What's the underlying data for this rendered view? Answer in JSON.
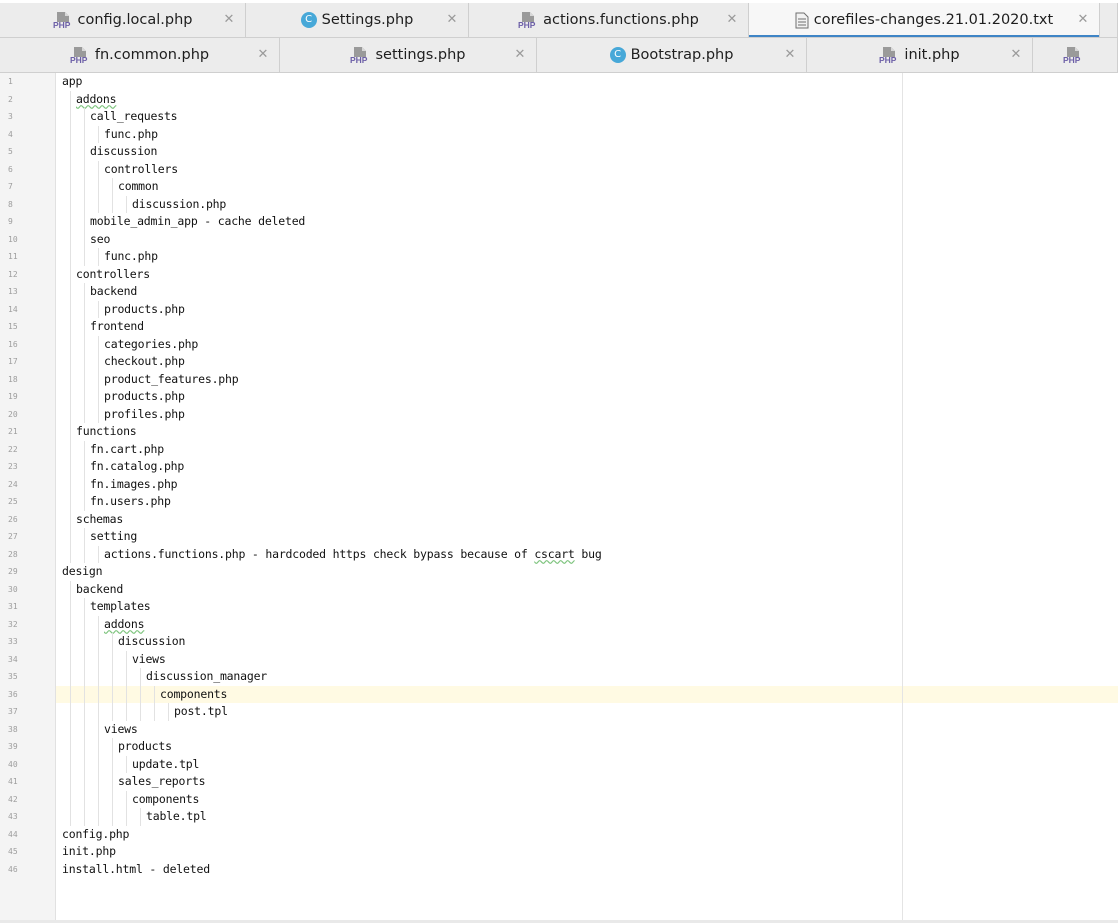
{
  "tabs_row_1": [
    {
      "label": "config.local.php",
      "icon": "php-file-icon",
      "active": false
    },
    {
      "label": "Settings.php",
      "icon": "class-icon",
      "active": false
    },
    {
      "label": "actions.functions.php",
      "icon": "php-file-icon",
      "active": false
    },
    {
      "label": "corefiles-changes.21.01.2020.txt",
      "icon": "text-file-icon",
      "active": true
    },
    {
      "label": "",
      "icon": "",
      "active": false
    }
  ],
  "tabs_row_2": [
    {
      "label": "fn.common.php",
      "icon": "php-file-icon",
      "active": false
    },
    {
      "label": "settings.php",
      "icon": "php-file-icon",
      "active": false
    },
    {
      "label": "Bootstrap.php",
      "icon": "class-icon",
      "active": false
    },
    {
      "label": "init.php",
      "icon": "php-file-icon",
      "active": false
    },
    {
      "label": "",
      "icon": "php-file-icon",
      "active": false
    }
  ],
  "icon_text": {
    "php": "PHP",
    "class": "C"
  },
  "close_glyph": "✕",
  "colors": {
    "active_tab_accent": "#3f85c6",
    "caret_line": "#fffae3",
    "class_icon": "#47a8d8",
    "php_icon": "#6c5fa7"
  },
  "caret_line_number": 36,
  "lines": [
    {
      "n": "1",
      "indent": 0,
      "text": "app"
    },
    {
      "n": "2",
      "indent": 1,
      "text": "addons",
      "squiggle": true
    },
    {
      "n": "3",
      "indent": 2,
      "text": "call_requests"
    },
    {
      "n": "4",
      "indent": 3,
      "text": "func.php"
    },
    {
      "n": "5",
      "indent": 2,
      "text": "discussion"
    },
    {
      "n": "6",
      "indent": 3,
      "text": "controllers"
    },
    {
      "n": "7",
      "indent": 4,
      "text": "common"
    },
    {
      "n": "8",
      "indent": 5,
      "text": "discussion.php"
    },
    {
      "n": "9",
      "indent": 2,
      "text": "mobile_admin_app - cache deleted"
    },
    {
      "n": "10",
      "indent": 2,
      "text": "seo"
    },
    {
      "n": "11",
      "indent": 3,
      "text": "func.php"
    },
    {
      "n": "12",
      "indent": 1,
      "text": "controllers"
    },
    {
      "n": "13",
      "indent": 2,
      "text": "backend"
    },
    {
      "n": "14",
      "indent": 3,
      "text": "products.php"
    },
    {
      "n": "15",
      "indent": 2,
      "text": "frontend"
    },
    {
      "n": "16",
      "indent": 3,
      "text": "categories.php"
    },
    {
      "n": "17",
      "indent": 3,
      "text": "checkout.php"
    },
    {
      "n": "18",
      "indent": 3,
      "text": "product_features.php"
    },
    {
      "n": "19",
      "indent": 3,
      "text": "products.php"
    },
    {
      "n": "20",
      "indent": 3,
      "text": "profiles.php"
    },
    {
      "n": "21",
      "indent": 1,
      "text": "functions"
    },
    {
      "n": "22",
      "indent": 2,
      "text": "fn.cart.php"
    },
    {
      "n": "23",
      "indent": 2,
      "text": "fn.catalog.php"
    },
    {
      "n": "24",
      "indent": 2,
      "text": "fn.images.php"
    },
    {
      "n": "25",
      "indent": 2,
      "text": "fn.users.php"
    },
    {
      "n": "26",
      "indent": 1,
      "text": "schemas"
    },
    {
      "n": "27",
      "indent": 2,
      "text": "setting"
    },
    {
      "n": "28",
      "indent": 3,
      "text": "actions.functions.php - hardcoded https check bypass because of cscart bug"
    },
    {
      "n": "29",
      "indent": 0,
      "text": "design"
    },
    {
      "n": "30",
      "indent": 1,
      "text": "backend"
    },
    {
      "n": "31",
      "indent": 2,
      "text": "templates"
    },
    {
      "n": "32",
      "indent": 3,
      "text": "addons",
      "squiggle": true
    },
    {
      "n": "33",
      "indent": 4,
      "text": "discussion"
    },
    {
      "n": "34",
      "indent": 5,
      "text": "views"
    },
    {
      "n": "35",
      "indent": 6,
      "text": "discussion_manager"
    },
    {
      "n": "36",
      "indent": 7,
      "text": "components"
    },
    {
      "n": "37",
      "indent": 8,
      "text": "post.tpl"
    },
    {
      "n": "38",
      "indent": 3,
      "text": "views"
    },
    {
      "n": "39",
      "indent": 4,
      "text": "products"
    },
    {
      "n": "40",
      "indent": 5,
      "text": "update.tpl"
    },
    {
      "n": "41",
      "indent": 4,
      "text": "sales_reports"
    },
    {
      "n": "42",
      "indent": 5,
      "text": "components"
    },
    {
      "n": "43",
      "indent": 6,
      "text": "table.tpl"
    },
    {
      "n": "44",
      "indent": 0,
      "text": "config.php"
    },
    {
      "n": "45",
      "indent": 0,
      "text": "init.php"
    },
    {
      "n": "46",
      "indent": 0,
      "text": "install.html - deleted"
    }
  ]
}
